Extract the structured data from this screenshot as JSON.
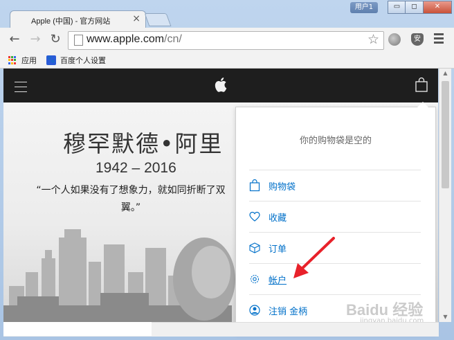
{
  "window": {
    "user_badge": "用户1",
    "minimize_glyph": "▭",
    "maximize_glyph": "◻",
    "close_glyph": "✕"
  },
  "tab": {
    "title": "Apple (中国) - 官方网站",
    "close_glyph": "×",
    "favicon": "apple-icon"
  },
  "toolbar": {
    "back_glyph": "←",
    "forward_glyph": "→",
    "reload_glyph": "↻",
    "url_host": "www.apple.com",
    "url_path": "/cn/",
    "star_glyph": "☆",
    "shield_letter": "安"
  },
  "bookmarks": {
    "items": [
      {
        "label": "应用",
        "icon": "apps-grid-icon"
      },
      {
        "label": "百度个人设置",
        "icon": "baidu-paw-icon"
      }
    ]
  },
  "hero": {
    "name": "穆罕默德•阿里",
    "years": "1942 – 2016",
    "quote_line1": "“一个人如果没有了想象力，就如同折断了双",
    "quote_line2": "翼。”"
  },
  "bag_menu": {
    "empty_message": "你的购物袋是空的",
    "items": [
      {
        "label": "购物袋",
        "icon": "bag-icon"
      },
      {
        "label": "收藏",
        "icon": "heart-icon"
      },
      {
        "label": "订单",
        "icon": "box-icon"
      },
      {
        "label": "帐户",
        "icon": "gear-icon"
      },
      {
        "label": "注销 金柄",
        "icon": "person-icon"
      }
    ]
  },
  "watermark": {
    "text": "Baidu 经验",
    "sub": "jingyan.baidu.com"
  },
  "colors": {
    "link": "#0070c9",
    "nav_bg": "#1e1e1e",
    "annotation": "#e8212a"
  }
}
